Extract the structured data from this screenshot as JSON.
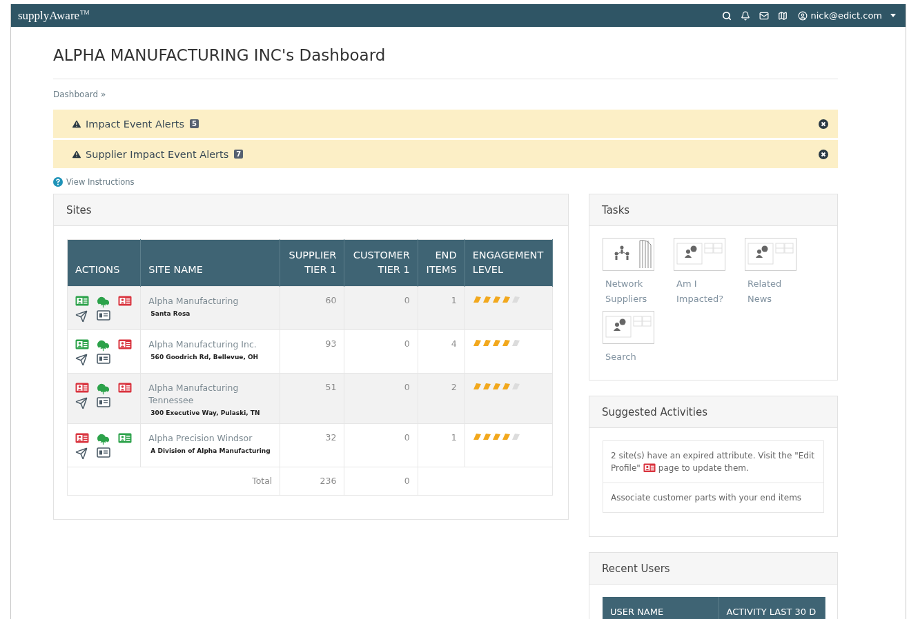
{
  "topbar": {
    "brand": "supplyAware",
    "trademark": "TM",
    "user": "nick@edict.com"
  },
  "page": {
    "title": "ALPHA MANUFACTURING INC's Dashboard",
    "breadcrumb": "Dashboard »"
  },
  "alerts": [
    {
      "label": "Impact Event Alerts",
      "count": "5"
    },
    {
      "label": "Supplier Impact Event Alerts",
      "count": "7"
    }
  ],
  "instructions_link": "View Instructions",
  "sites": {
    "title": "Sites",
    "columns": [
      {
        "line2": "ACTIONS"
      },
      {
        "line2": "SITE NAME"
      },
      {
        "line1": "SUPPLIER",
        "line2": "TIER 1"
      },
      {
        "line1": "CUSTOMER",
        "line2": "TIER 1"
      },
      {
        "line1": "END",
        "line2": "ITEMS"
      },
      {
        "line1": "ENGAGEMENT",
        "line2": "LEVEL"
      }
    ],
    "rows": [
      {
        "actions": [
          {
            "kind": "profile",
            "color": "#2ca24a"
          },
          {
            "kind": "upload"
          },
          {
            "kind": "profile",
            "color": "#d9343f"
          },
          {
            "kind": "send"
          },
          {
            "kind": "card"
          }
        ],
        "name": "Alpha Manufacturing",
        "address": "Santa Rosa",
        "supplier_tier_1": "60",
        "customer_tier_1": "0",
        "end_items": "1",
        "stars": 4
      },
      {
        "actions": [
          {
            "kind": "profile",
            "color": "#2ca24a"
          },
          {
            "kind": "upload"
          },
          {
            "kind": "profile",
            "color": "#d9343f"
          },
          {
            "kind": "send"
          },
          {
            "kind": "card"
          }
        ],
        "name": "Alpha Manufacturing Inc.",
        "address": "560 Goodrich Rd, Bellevue, OH",
        "supplier_tier_1": "93",
        "customer_tier_1": "0",
        "end_items": "4",
        "stars": 4
      },
      {
        "actions": [
          {
            "kind": "profile",
            "color": "#d9343f"
          },
          {
            "kind": "upload"
          },
          {
            "kind": "profile",
            "color": "#d9343f"
          },
          {
            "kind": "send"
          },
          {
            "kind": "card"
          }
        ],
        "name": "Alpha Manufacturing Tennessee",
        "address": "300 Executive Way, Pulaski, TN",
        "supplier_tier_1": "51",
        "customer_tier_1": "0",
        "end_items": "2",
        "stars": 4
      },
      {
        "actions": [
          {
            "kind": "profile",
            "color": "#d9343f"
          },
          {
            "kind": "upload"
          },
          {
            "kind": "profile",
            "color": "#2ca24a"
          },
          {
            "kind": "send"
          },
          {
            "kind": "card"
          }
        ],
        "name": "Alpha Precision Windsor",
        "address": "A Division of Alpha Manufacturing",
        "supplier_tier_1": "32",
        "customer_tier_1": "0",
        "end_items": "1",
        "stars": 4
      }
    ],
    "total": {
      "label": "Total",
      "supplier_tier_1": "236",
      "customer_tier_1": "0"
    }
  },
  "tasks": {
    "title": "Tasks",
    "items": [
      {
        "kind": "network",
        "label": "Network Suppliers"
      },
      {
        "kind": "profile",
        "label": "Am I Impacted?"
      },
      {
        "kind": "profile",
        "label": "Related News"
      },
      {
        "kind": "profile",
        "label": "Search"
      }
    ]
  },
  "suggested": {
    "title": "Suggested Activities",
    "items": [
      {
        "kind": "with_icon",
        "text": "2 site(s) have an expired attribute. Visit the \"Edit",
        "text_before_icon": "Profile\"",
        "text_after": "page to update them."
      },
      {
        "kind": "plain",
        "text": "Associate customer parts with your end items"
      }
    ]
  },
  "recent_users": {
    "title": "Recent Users",
    "columns": [
      "USER NAME",
      "ACTIVITY LAST 30 D"
    ]
  }
}
